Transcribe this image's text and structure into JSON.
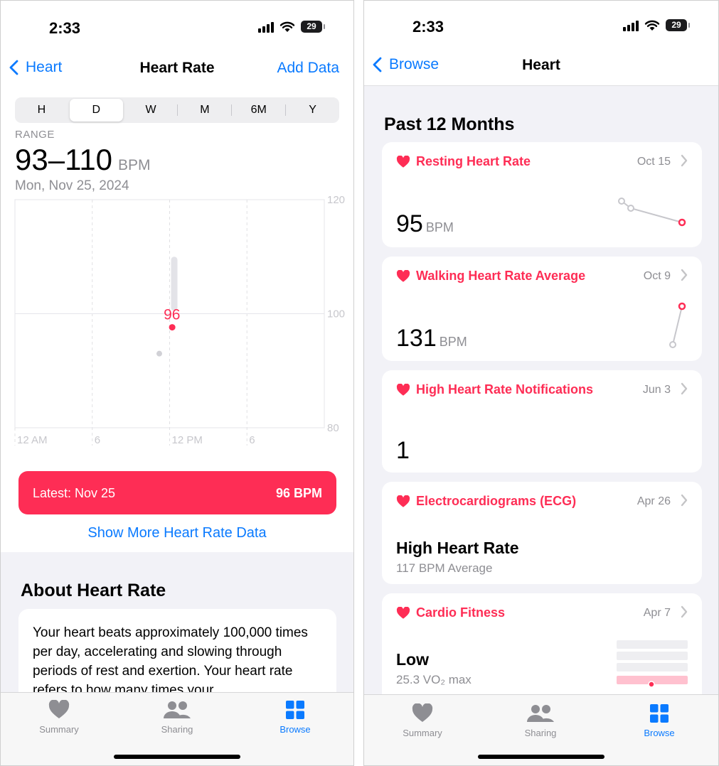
{
  "left": {
    "status": {
      "time": "2:33",
      "battery": "29"
    },
    "nav": {
      "back_label": "Heart",
      "title": "Heart Rate",
      "action": "Add Data"
    },
    "segments": [
      {
        "label": "H",
        "selected": false
      },
      {
        "label": "D",
        "selected": true
      },
      {
        "label": "W",
        "selected": false
      },
      {
        "label": "M",
        "selected": false
      },
      {
        "label": "6M",
        "selected": false
      },
      {
        "label": "Y",
        "selected": false
      }
    ],
    "range": {
      "label": "RANGE",
      "value": "93–110",
      "unit": "BPM",
      "date": "Mon, Nov 25, 2024"
    },
    "latest": {
      "label": "Latest: Nov 25",
      "value": "96 BPM"
    },
    "more_link": "Show More Heart Rate Data",
    "about": {
      "title": "About Heart Rate",
      "text": "Your heart beats approximately 100,000 times per day, accelerating and slowing through periods of rest and exertion. Your heart rate refers to how many times your"
    },
    "tabs": [
      {
        "label": "Summary",
        "icon": "heart-icon",
        "active": false
      },
      {
        "label": "Sharing",
        "icon": "people-icon",
        "active": false
      },
      {
        "label": "Browse",
        "icon": "grid-icon",
        "active": true
      }
    ]
  },
  "right": {
    "status": {
      "time": "2:33",
      "battery": "29"
    },
    "nav": {
      "back_label": "Browse",
      "title": "Heart"
    },
    "section_title": "Past 12 Months",
    "cards": [
      {
        "title": "Resting Heart Rate",
        "date": "Oct 15",
        "value": "95",
        "unit": "BPM"
      },
      {
        "title": "Walking Heart Rate Average",
        "date": "Oct 9",
        "value": "131",
        "unit": "BPM"
      },
      {
        "title": "High Heart Rate Notifications",
        "date": "Jun 3",
        "value": "1"
      },
      {
        "title": "Electrocardiograms (ECG)",
        "date": "Apr 26",
        "value": "High Heart Rate",
        "sub": "117 BPM Average"
      },
      {
        "title": "Cardio Fitness",
        "date": "Apr 7",
        "value": "Low",
        "sub": "25.3 VO₂ max"
      }
    ],
    "tabs": [
      {
        "label": "Summary",
        "icon": "heart-icon",
        "active": false
      },
      {
        "label": "Sharing",
        "icon": "people-icon",
        "active": false
      },
      {
        "label": "Browse",
        "icon": "grid-icon",
        "active": true
      }
    ]
  },
  "chart_data": {
    "type": "scatter",
    "x_ticks": [
      "12 AM",
      "6",
      "12 PM",
      "6"
    ],
    "y_ticks": [
      80,
      100,
      120
    ],
    "ylim": [
      80,
      120
    ],
    "range_bar": {
      "x_hour": 12,
      "low": 100.5,
      "high": 110
    },
    "selected_point": {
      "x_hour": 12.2,
      "value": 96,
      "label": "96"
    },
    "other_point": {
      "x_hour": 11.2,
      "value": 93
    }
  },
  "colors": {
    "accent": "#0a7aff",
    "heart": "#fe2d55"
  }
}
